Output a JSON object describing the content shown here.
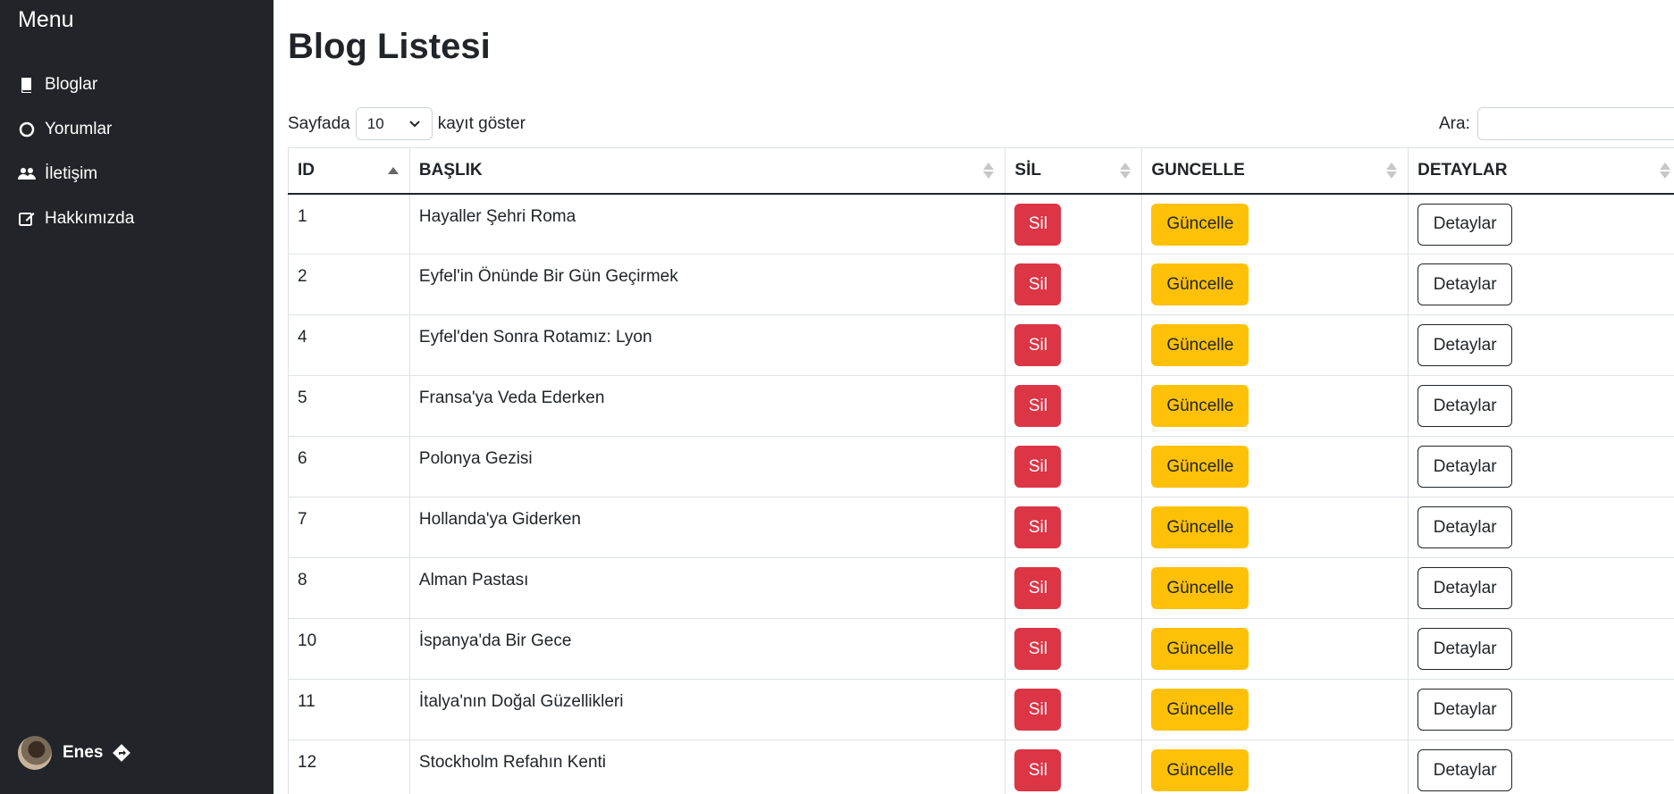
{
  "sidebar": {
    "title": "Menu",
    "items": [
      {
        "label": "Bloglar",
        "icon": "book-icon"
      },
      {
        "label": "Yorumlar",
        "icon": "comment-icon"
      },
      {
        "label": "İletişim",
        "icon": "people-icon"
      },
      {
        "label": "Hakkımızda",
        "icon": "edit-icon"
      }
    ],
    "user": {
      "name": "Enes"
    }
  },
  "page": {
    "title": "Blog Listesi",
    "length_prefix": "Sayfada",
    "length_value": "10",
    "length_suffix": "kayıt göster",
    "search_label": "Ara:",
    "search_value": ""
  },
  "table": {
    "columns": [
      "ID",
      "BAŞLIK",
      "SİL",
      "GUNCELLE",
      "DETAYLAR"
    ],
    "sorted_column": "ID",
    "delete_label": "Sil",
    "update_label": "Güncelle",
    "details_label": "Detaylar",
    "rows": [
      {
        "id": "1",
        "title": "Hayaller Şehri Roma"
      },
      {
        "id": "2",
        "title": "Eyfel'in Önünde Bir Gün Geçirmek"
      },
      {
        "id": "4",
        "title": "Eyfel'den Sonra Rotamız: Lyon"
      },
      {
        "id": "5",
        "title": "Fransa'ya Veda Ederken"
      },
      {
        "id": "6",
        "title": "Polonya Gezisi"
      },
      {
        "id": "7",
        "title": "Hollanda'ya Giderken"
      },
      {
        "id": "8",
        "title": "Alman Pastası"
      },
      {
        "id": "10",
        "title": "İspanya'da Bir Gece"
      },
      {
        "id": "11",
        "title": "İtalya'nın Doğal Güzellikleri"
      },
      {
        "id": "12",
        "title": "Stockholm Refahın Kenti"
      }
    ]
  },
  "colors": {
    "sidebar_bg": "#212529",
    "danger": "#dc3545",
    "warning": "#ffc107"
  }
}
